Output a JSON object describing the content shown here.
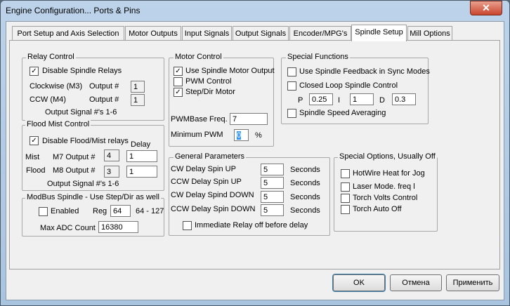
{
  "window": {
    "title": "Engine Configuration... Ports & Pins",
    "close_glyph": "✕"
  },
  "tabs": [
    "Port Setup and Axis Selection",
    "Motor Outputs",
    "Input Signals",
    "Output Signals",
    "Encoder/MPG's",
    "Spindle Setup",
    "Mill Options"
  ],
  "relay": {
    "title": "Relay Control",
    "disable_label": "Disable Spindle Relays",
    "cw_label": "Clockwise (M3)",
    "ccw_label": "CCW (M4)",
    "output_label": "Output #",
    "cw_value": "1",
    "ccw_value": "1",
    "footer": "Output Signal #'s 1-6"
  },
  "flood": {
    "title": "Flood Mist Control",
    "disable_label": "Disable Flood/Mist relays",
    "delay_label": "Delay",
    "mist_label": "Mist",
    "m7_label": "M7 Output #",
    "m7_value": "4",
    "mist_delay": "1",
    "flood_label": "Flood",
    "m8_label": "M8 Output #",
    "m8_value": "3",
    "flood_delay": "1",
    "footer": "Output Signal #'s 1-6"
  },
  "modbus": {
    "title": "ModBus Spindle - Use Step/Dir as well",
    "enabled_label": "Enabled",
    "reg_label": "Reg",
    "reg_value": "64",
    "range": "64 - 127",
    "max_adc_label": "Max ADC Count",
    "max_adc_value": "16380"
  },
  "motor": {
    "title": "Motor Control",
    "use_spindle": "Use Spindle Motor Output",
    "pwm": "PWM Control",
    "stepdir": "Step/Dir Motor",
    "pwm_base_label": "PWMBase Freq.",
    "pwm_base_value": "7",
    "min_pwm_label": "Minimum PWM",
    "min_pwm_value": "0",
    "percent": "%"
  },
  "special": {
    "title": "Special Functions",
    "feedback": "Use Spindle Feedback in Sync Modes",
    "closed_loop": "Closed Loop Spindle Control",
    "p_label": "P",
    "p_value": "0.25",
    "i_label": "I",
    "i_value": "1",
    "d_label": "D",
    "d_value": "0.3",
    "averaging": "Spindle Speed Averaging"
  },
  "general": {
    "title": "General Parameters",
    "rows": [
      {
        "label": "CW Delay Spin UP",
        "value": "5"
      },
      {
        "label": "CCW Delay Spin UP",
        "value": "5"
      },
      {
        "label": "CW Delay Spind DOWN",
        "value": "5"
      },
      {
        "label": "CCW Delay Spin DOWN",
        "value": "5"
      }
    ],
    "unit": "Seconds",
    "immediate": "Immediate Relay off before delay"
  },
  "options": {
    "title": "Special Options, Usually Off",
    "items": [
      "HotWire Heat for Jog",
      "Laser Mode. freq l",
      "Torch Volts Control",
      "Torch Auto Off"
    ]
  },
  "buttons": {
    "ok": "OK",
    "cancel": "Отмена",
    "apply": "Применить"
  }
}
